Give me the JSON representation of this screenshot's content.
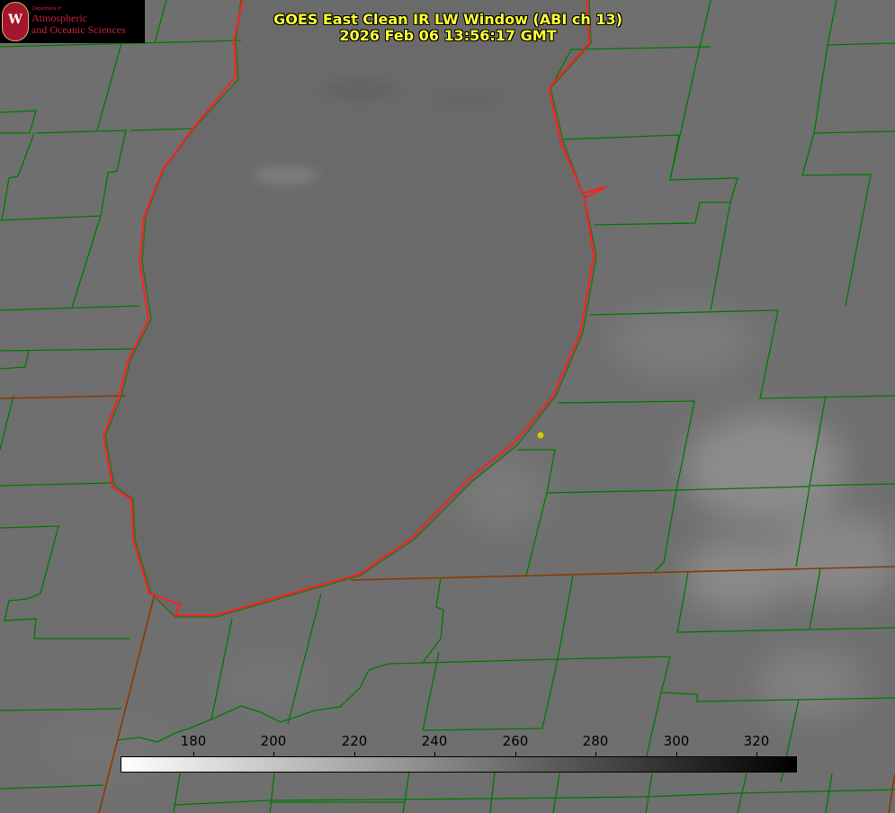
{
  "title": {
    "line1": "GOES East Clean IR LW Window (ABI ch 13)",
    "line2": "2026 Feb 06 13:56:17 GMT"
  },
  "logo": {
    "seal_letter": "W",
    "department": "Department of",
    "line1": "Atmospheric",
    "line2": "and Oceanic Sciences"
  },
  "colorbar": {
    "min": 160,
    "max": 335,
    "ticks": [
      "180",
      "200",
      "220",
      "240",
      "260",
      "280",
      "300",
      "320"
    ],
    "colormap": "white-to-black"
  },
  "colors": {
    "background": "#6f6f6f",
    "lake": "#6a6a6a",
    "county_lines": "#007a00",
    "state_lines": "#8a3a00",
    "shoreline": "#ff2020",
    "title": "#ffff33",
    "marker": "#d8c800"
  }
}
